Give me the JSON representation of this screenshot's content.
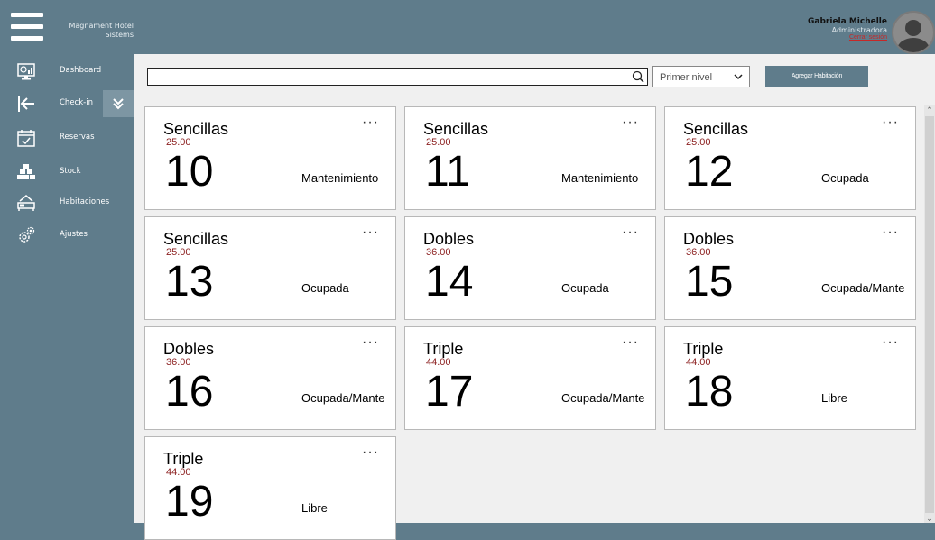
{
  "app": {
    "brand_line1": "Magnament Hotel",
    "brand_line2": "Sistems"
  },
  "user": {
    "name": "Gabriela Michelle",
    "role": "Administradora",
    "logout": "Cerrar sesión"
  },
  "sidebar": {
    "items": [
      {
        "label": "Dashboard",
        "icon": "dashboard-icon"
      },
      {
        "label": "Check-in",
        "icon": "check-in-icon"
      },
      {
        "label": "Reservas",
        "icon": "calendar-icon"
      },
      {
        "label": "Stock",
        "icon": "boxes-icon"
      },
      {
        "label": "Habitaciones",
        "icon": "bed-icon"
      },
      {
        "label": "Ajustes",
        "icon": "gear-icon"
      }
    ]
  },
  "toolbar": {
    "search_value": "",
    "select_value": "Primer nivel",
    "add_label": "Agregar Habitación"
  },
  "rooms": [
    {
      "type": "Sencillas",
      "price": "25.00",
      "number": "10",
      "status": "Mantenimiento"
    },
    {
      "type": "Sencillas",
      "price": "25.00",
      "number": "11",
      "status": "Mantenimiento"
    },
    {
      "type": "Sencillas",
      "price": "25.00",
      "number": "12",
      "status": "Ocupada"
    },
    {
      "type": "Sencillas",
      "price": "25.00",
      "number": "13",
      "status": "Ocupada"
    },
    {
      "type": "Dobles",
      "price": "36.00",
      "number": "14",
      "status": "Ocupada"
    },
    {
      "type": "Dobles",
      "price": "36.00",
      "number": "15",
      "status": "Ocupada/Mante"
    },
    {
      "type": "Dobles",
      "price": "36.00",
      "number": "16",
      "status": "Ocupada/Mante"
    },
    {
      "type": "Triple",
      "price": "44.00",
      "number": "17",
      "status": "Ocupada/Mante"
    },
    {
      "type": "Triple",
      "price": "44.00",
      "number": "18",
      "status": "Libre"
    },
    {
      "type": "Triple",
      "price": "44.00",
      "number": "19",
      "status": "Libre"
    }
  ],
  "card_menu_glyph": "···",
  "colors": {
    "sidebar": "#5f7c8b",
    "price": "#8b1e1e",
    "logout": "#c62828"
  }
}
